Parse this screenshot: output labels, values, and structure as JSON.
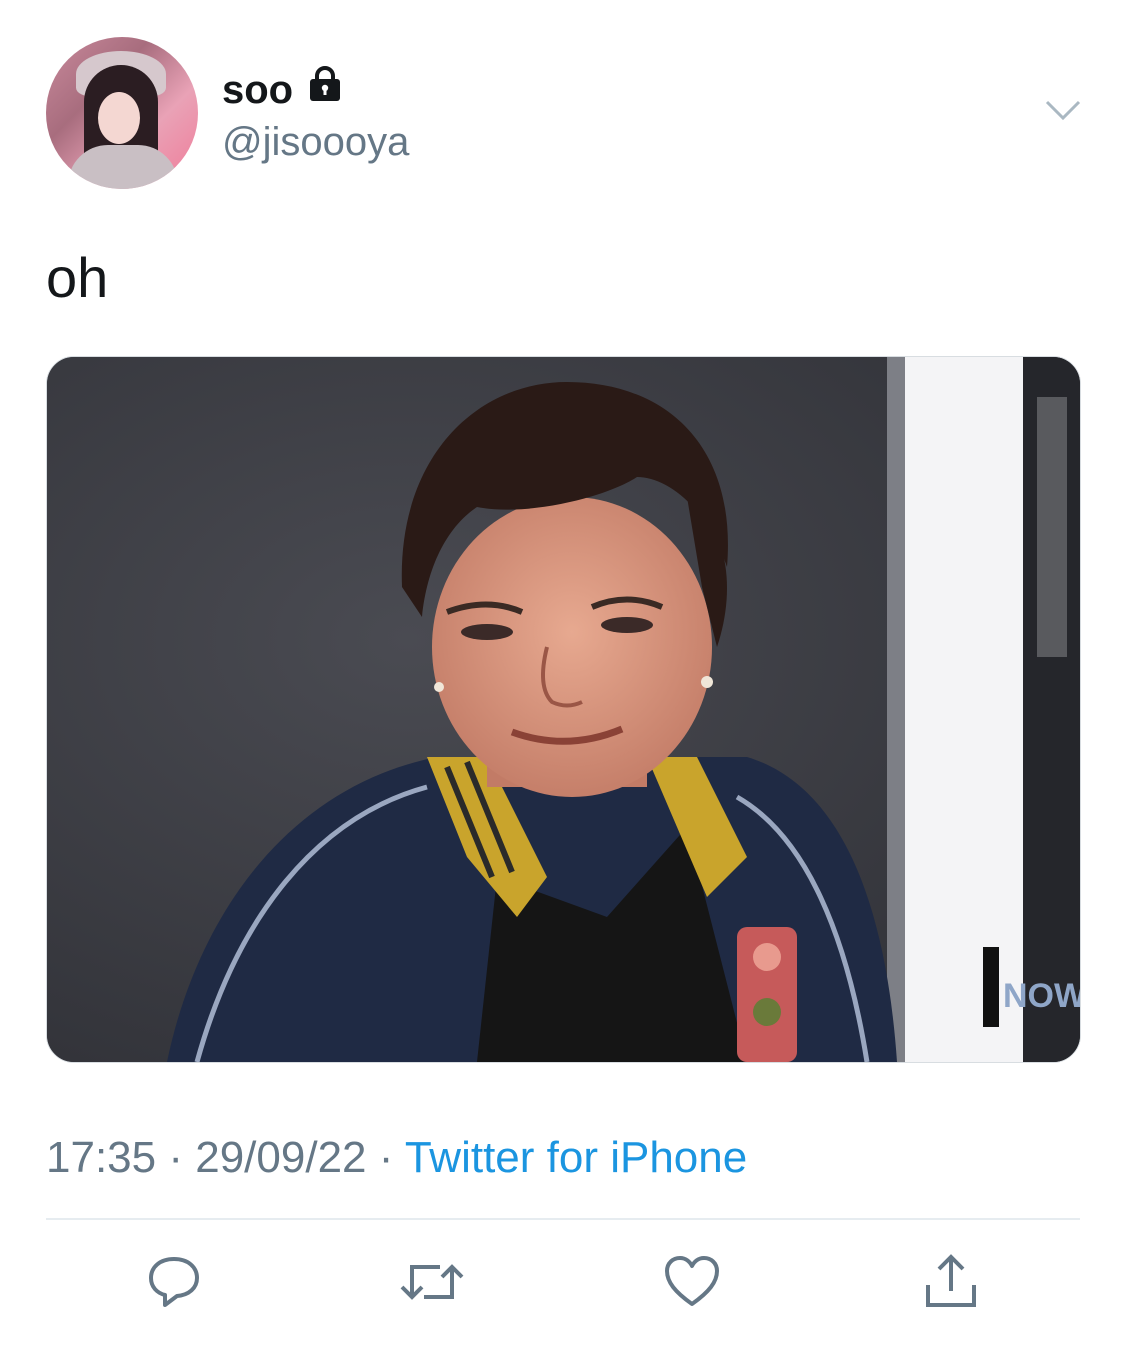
{
  "user": {
    "display_name": "soo",
    "handle": "@jisoooya",
    "avatar_icon": "profile-photo",
    "locked_icon": "lock-icon"
  },
  "tweet": {
    "text": "oh",
    "time": "17:35",
    "date": "29/09/22",
    "separator": "·",
    "source": "Twitter for iPhone",
    "media_watermark": "E NOW"
  },
  "actions": {
    "reply_icon": "reply-icon",
    "retweet_icon": "retweet-icon",
    "like_icon": "heart-icon",
    "share_icon": "share-icon"
  },
  "colors": {
    "text_primary": "#14171a",
    "text_secondary": "#657786",
    "link": "#1b95e0",
    "divider": "#e6ecf0",
    "icon": "#657786"
  }
}
